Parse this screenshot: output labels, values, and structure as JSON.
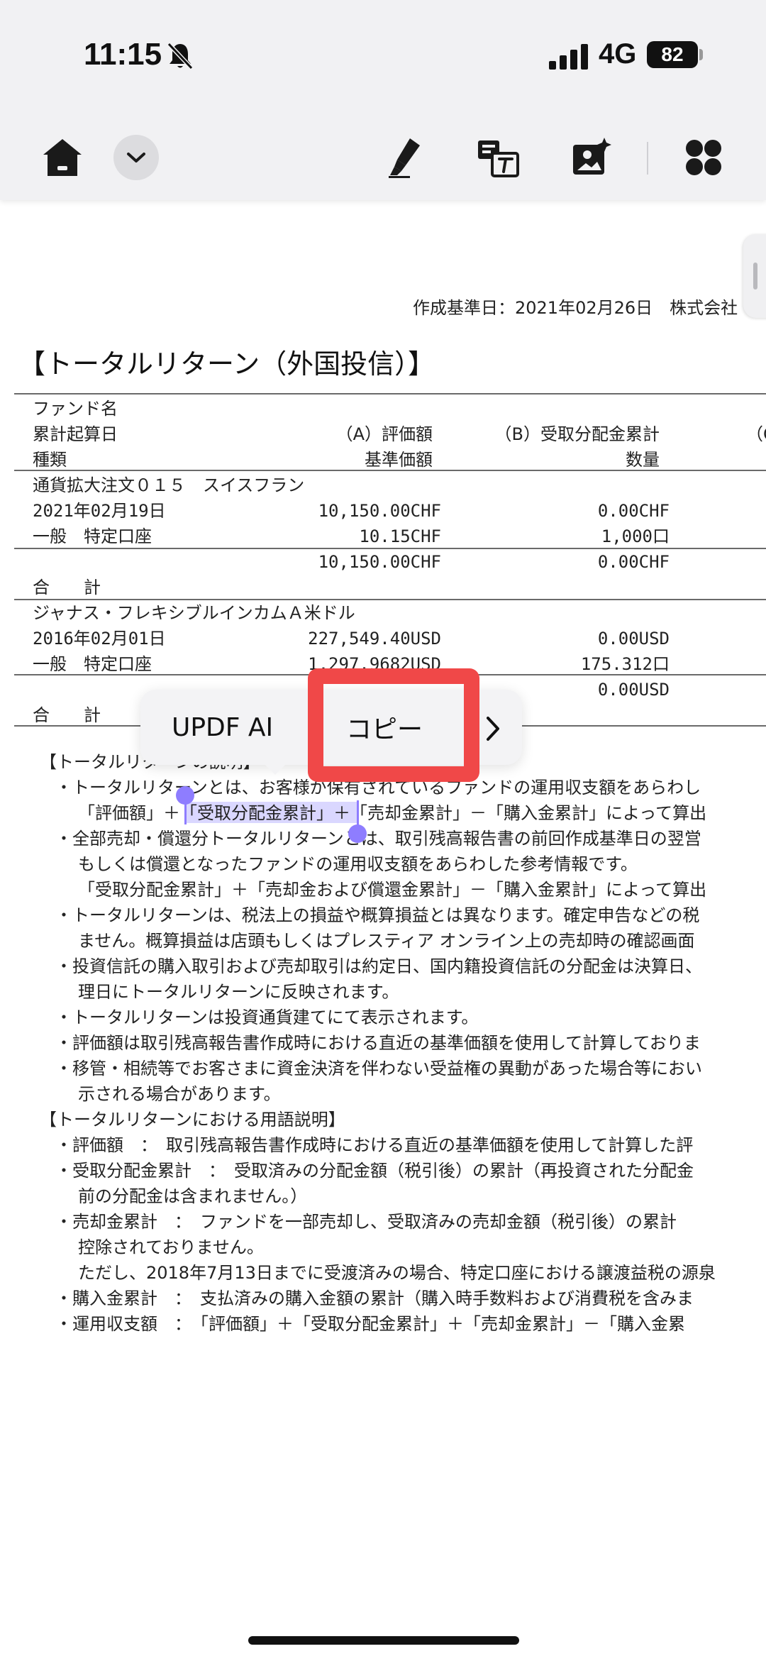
{
  "status_bar": {
    "time": "11:15",
    "network": "4G",
    "battery": "82"
  },
  "toolbar": {
    "icons": [
      "home-icon",
      "chevron-down-icon",
      "highlighter-icon",
      "translate-icon",
      "ai-image-icon",
      "apps-icon"
    ]
  },
  "document": {
    "header_date": "作成基準日：2021年02月26日　株式会社",
    "title": "【トータルリターン（外国投信）】",
    "table": {
      "head": {
        "col1": [
          "ファンド名",
          "累計起算日",
          "種類"
        ],
        "col2": [
          "（A）評価額",
          "基準価額"
        ],
        "col3": [
          "（B）受取分配金累計",
          "数量"
        ],
        "col4": "（C"
      },
      "fund1": {
        "name": "通貨拡大注文０１５　スイスフラン",
        "date": "2021年02月19日",
        "type": "一般　特定口座",
        "value": "10,150.00CHF",
        "price": "10.15CHF",
        "dist": "0.00CHF",
        "qty": "1,000口",
        "total_value": "10,150.00CHF",
        "total_dist": "0.00CHF",
        "total_label": "合　　計"
      },
      "fund2": {
        "name": "ジャナス・フレキシブルインカムＡ米ドル",
        "date": "2016年02月01日",
        "type": "一般　特定口座",
        "value": "227,549.40USD",
        "price": "1,297.9682USD",
        "dist": "0.00USD",
        "qty": "175.312口",
        "total_dist": "0.00USD",
        "total_label": "合　　計"
      }
    },
    "notes": [
      "【トータルリターンの説明】",
      "・トータルリターンとは、お客様が保有されているファンドの運用収支額をあらわし",
      "「評価額」＋「受取分配金累計」＋「売却金累計」－「購入金累計」によって算出",
      "・全部売却・償還分トータルリターンとは、取引残高報告書の前回作成基準日の翌営",
      "もしくは償還となったファンドの運用収支額をあらわした参考情報です。",
      "「受取分配金累計」＋「売却金および償還金累計」－「購入金累計」によって算出",
      "・トータルリターンは、税法上の損益や概算損益とは異なります。確定申告などの税",
      "ません。概算損益は店頭もしくはプレスティア オンライン上の売却時の確認画面",
      "・投資信託の購入取引および売却取引は約定日、国内籍投資信託の分配金は決算日、",
      "理日にトータルリターンに反映されます。",
      "・トータルリターンは投資通貨建てにて表示されます。",
      "・評価額は取引残高報告書作成時における直近の基準価額を使用して計算しておりま",
      "・移管・相続等でお客さまに資金決済を伴わない受益権の異動があった場合等におい",
      "示される場合があります。",
      "【トータルリターンにおける用語説明】",
      "・評価額　：　取引残高報告書作成時における直近の基準価額を使用して計算した評",
      "・受取分配金累計　：　受取済みの分配金額（税引後）の累計（再投資された分配金",
      "前の分配金は含まれません。）",
      "・売却金累計　：　ファンドを一部売却し、受取済みの売却金額（税引後）の累計",
      "控除されておりません。",
      "ただし、2018年7月13日までに受渡済みの場合、特定口座における譲渡益税の源泉",
      "・購入金累計　：　支払済みの購入金額の累計（購入時手数料および消費税を含みま",
      "・運用収支額　：　「評価額」＋「受取分配金累計」＋「売却金累計」－「購入金累"
    ]
  },
  "context_menu": {
    "updf_ai": "UPDF AI",
    "copy": "コピー"
  }
}
